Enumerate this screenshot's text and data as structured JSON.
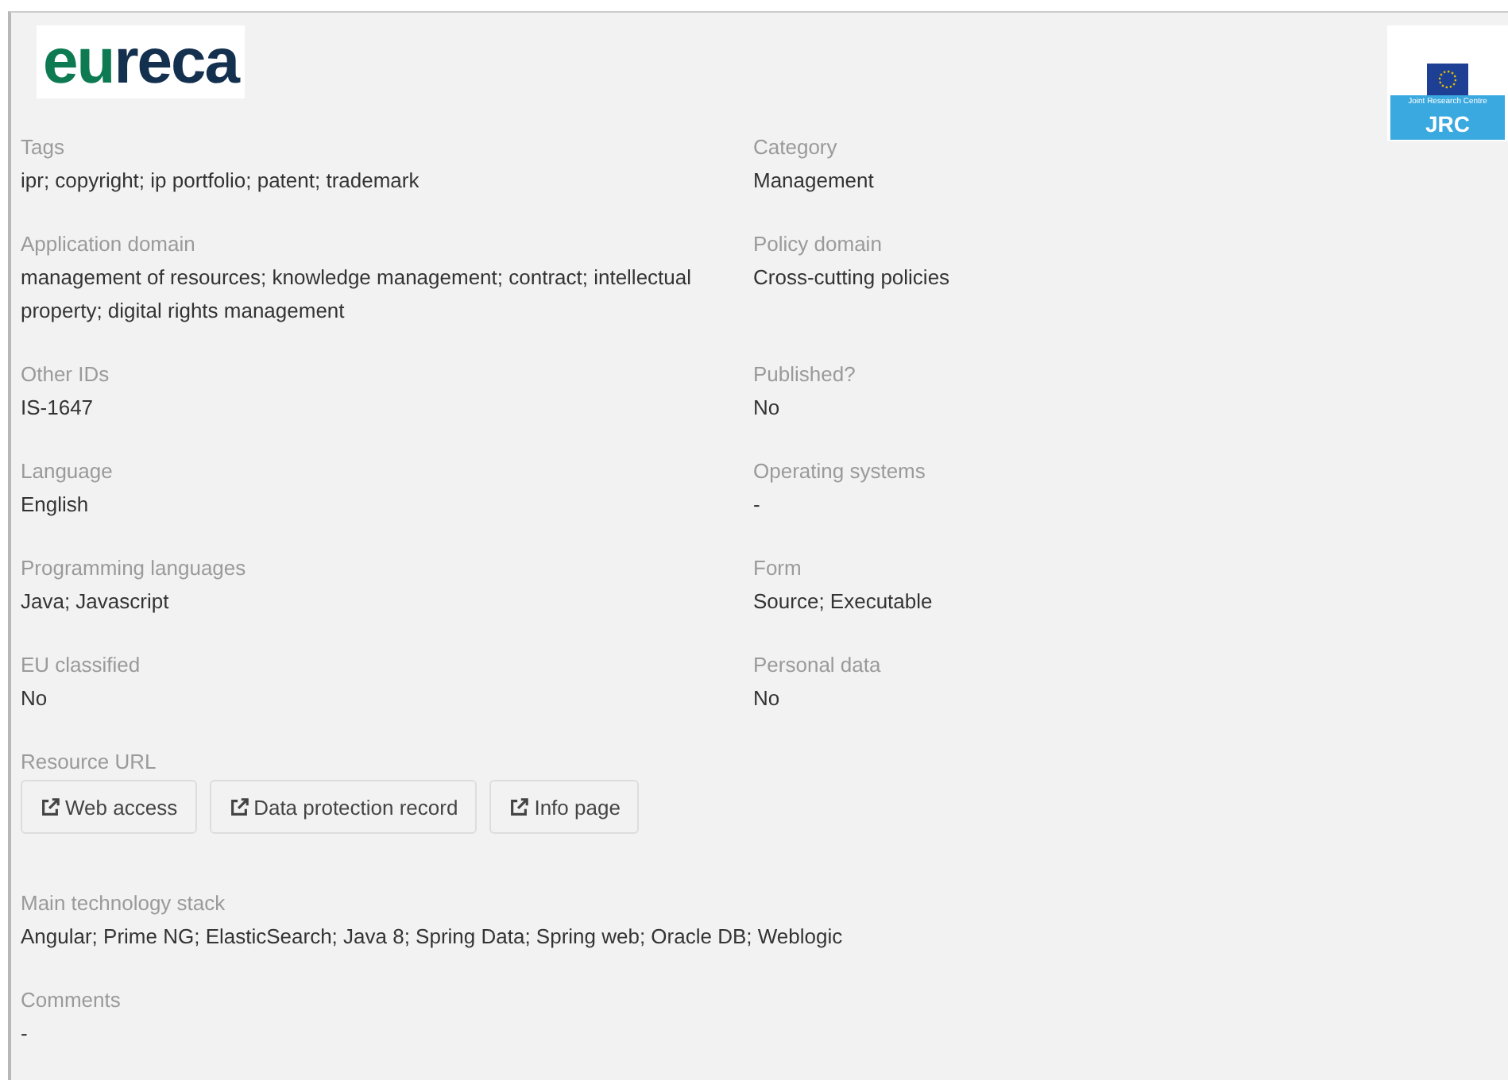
{
  "logo": {
    "part1": "eu",
    "part2": "reca"
  },
  "jrc_logo": {
    "caption": "Joint Research Centre",
    "name": "JRC"
  },
  "fields": [
    {
      "label": "Tags",
      "value": "ipr; copyright; ip portfolio; patent; trademark"
    },
    {
      "label": "Category",
      "value": "Management"
    },
    {
      "label": "Application domain",
      "value": "management of resources; knowledge management; contract; intellectual property; digital rights management"
    },
    {
      "label": "Policy domain",
      "value": "Cross-cutting policies"
    },
    {
      "label": "Other IDs",
      "value": "IS-1647"
    },
    {
      "label": "Published?",
      "value": "No"
    },
    {
      "label": "Language",
      "value": "English"
    },
    {
      "label": "Operating systems",
      "value": "-"
    },
    {
      "label": "Programming languages",
      "value": "Java; Javascript"
    },
    {
      "label": "Form",
      "value": "Source; Executable"
    },
    {
      "label": "EU classified",
      "value": "No"
    },
    {
      "label": "Personal data",
      "value": "No"
    }
  ],
  "resource_url": {
    "label": "Resource URL",
    "buttons": [
      "Web access",
      "Data protection record",
      "Info page"
    ]
  },
  "bottom_fields": [
    {
      "label": "Main technology stack",
      "value": "Angular; Prime NG; ElasticSearch; Java 8; Spring Data; Spring web; Oracle DB; Weblogic"
    },
    {
      "label": "Comments",
      "value": "-"
    }
  ]
}
